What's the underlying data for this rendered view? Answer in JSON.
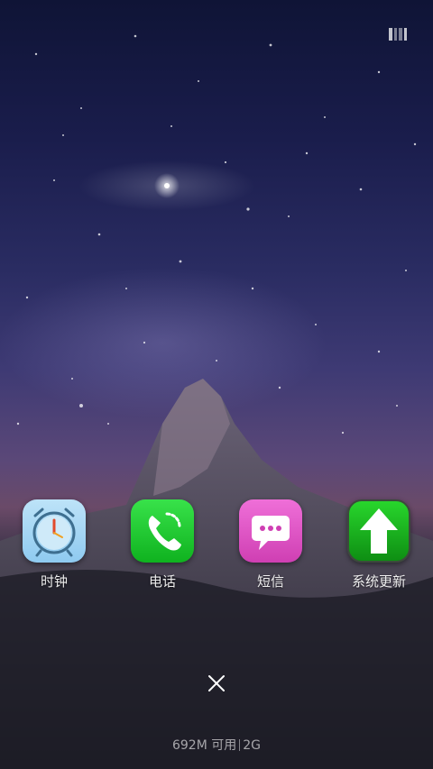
{
  "wallpaper": {
    "description_icon": "starry-mountain-wallpaper"
  },
  "status": {
    "icon": "recent-apps-icon"
  },
  "apps": [
    {
      "label": "时钟",
      "icon": "alarm-clock-icon",
      "color": "#9fd3f3"
    },
    {
      "label": "电话",
      "icon": "phone-icon",
      "color": "#22c935"
    },
    {
      "label": "短信",
      "icon": "message-icon",
      "color": "#e055c8"
    },
    {
      "label": "系统更新",
      "icon": "update-arrow-icon",
      "color": "#17b21e"
    }
  ],
  "close": {
    "icon": "close-icon"
  },
  "memory": {
    "available": "692M 可用",
    "network": "2G"
  }
}
